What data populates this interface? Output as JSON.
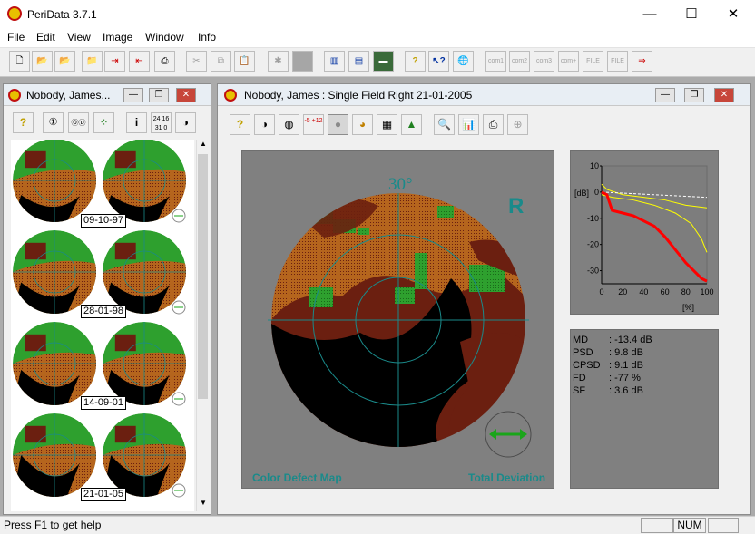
{
  "app": {
    "title": "PeriData 3.7.1",
    "minimize": "—",
    "maximize": "☐",
    "close": "✕"
  },
  "menu": [
    "File",
    "Edit",
    "View",
    "Image",
    "Window",
    "Info"
  ],
  "toolbar": {
    "com1": "com1",
    "com2": "com2",
    "com3": "com3",
    "complus": "com+",
    "file1": "FILE",
    "file2": "FILE"
  },
  "left_window": {
    "title": "Nobody, James...",
    "tools": {
      "t1": "?",
      "t2": "①",
      "t3": "ⓄⒹ",
      "t4": "i",
      "t5": "24 16 31 0"
    },
    "exams": [
      {
        "date": "09-10-97"
      },
      {
        "date": "28-01-98"
      },
      {
        "date": "14-09-01"
      },
      {
        "date": "21-01-05"
      }
    ]
  },
  "main_window": {
    "title": "Nobody, James :  Single Field  Right  21-01-2005",
    "tools": {
      "t1": "?",
      "t4": "-5 +12"
    },
    "map": {
      "angle_label": "30°",
      "eye": "R",
      "left_caption": "Color Defect Map",
      "right_caption": "Total Deviation"
    },
    "curve": {
      "ylabel": "[dB]",
      "xunit": "[%]",
      "yticks": [
        "10",
        "0",
        "-10",
        "-20",
        "-30"
      ],
      "xticks": [
        "0",
        "20",
        "40",
        "60",
        "80",
        "100"
      ],
      "colors": {
        "patient": "#ff0000",
        "normal_band": "#ffff00",
        "reference": "#ffffff"
      }
    },
    "stats": [
      {
        "label": "MD",
        "value": ":  -13.4 dB"
      },
      {
        "label": "PSD",
        "value": ":  9.8 dB"
      },
      {
        "label": "CPSD",
        "value": ":  9.1 dB"
      },
      {
        "label": "FD",
        "value": ":  -77 %"
      },
      {
        "label": "SF",
        "value": ":  3.6 dB"
      }
    ]
  },
  "status": {
    "help": "Press F1 to get help",
    "num": "NUM"
  },
  "colors": {
    "normal_green": "#2ea02e",
    "mild_orange": "#b5651d",
    "moderate_brown": "#6b1f10",
    "severe_black": "#000000",
    "accent_teal": "#1a8a8a"
  }
}
